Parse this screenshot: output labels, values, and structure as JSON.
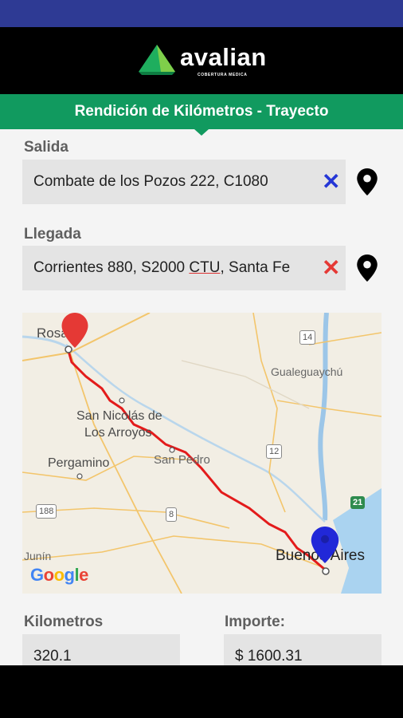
{
  "app": {
    "brand": "avalian",
    "tagline": "COBERTURA MEDICA"
  },
  "screen_title": "Rendición de Kilómetros - Trayecto",
  "salida": {
    "label": "Salida",
    "value": "Combate de los Pozos 222, C1080",
    "clear_color": "#2436d6",
    "pin_icon": "map-pin"
  },
  "llegada": {
    "label": "Llegada",
    "value_pre": "Corrientes 880, S2000 ",
    "value_ctu": "CTU",
    "value_post": ", Santa Fe",
    "clear_color": "#e53935",
    "pin_icon": "map-pin"
  },
  "map": {
    "places": {
      "rosario": "Rosario",
      "san_nicolas_1": "San Nicolás de",
      "san_nicolas_2": "Los Arroyos",
      "pergamino": "Pergamino",
      "san_pedro": "San Pedro",
      "gualeguaychu": "Gualeguaychú",
      "junin": "Junín",
      "buenos_aires": "Buenos Aires"
    },
    "routes": {
      "r14": "14",
      "r12": "12",
      "r188": "188",
      "r8": "8",
      "r21": "21"
    },
    "attribution": {
      "G": "G",
      "o1": "o",
      "o2": "o",
      "g": "g",
      "l": "l",
      "e": "e"
    },
    "origin_marker_color": "#e53935",
    "destination_marker_color": "#2128d8",
    "route_color": "#e31b1b"
  },
  "kilometros": {
    "label": "Kilometros",
    "value": "320.1"
  },
  "importe": {
    "label": "Importe:",
    "value": "$ 1600.31"
  }
}
